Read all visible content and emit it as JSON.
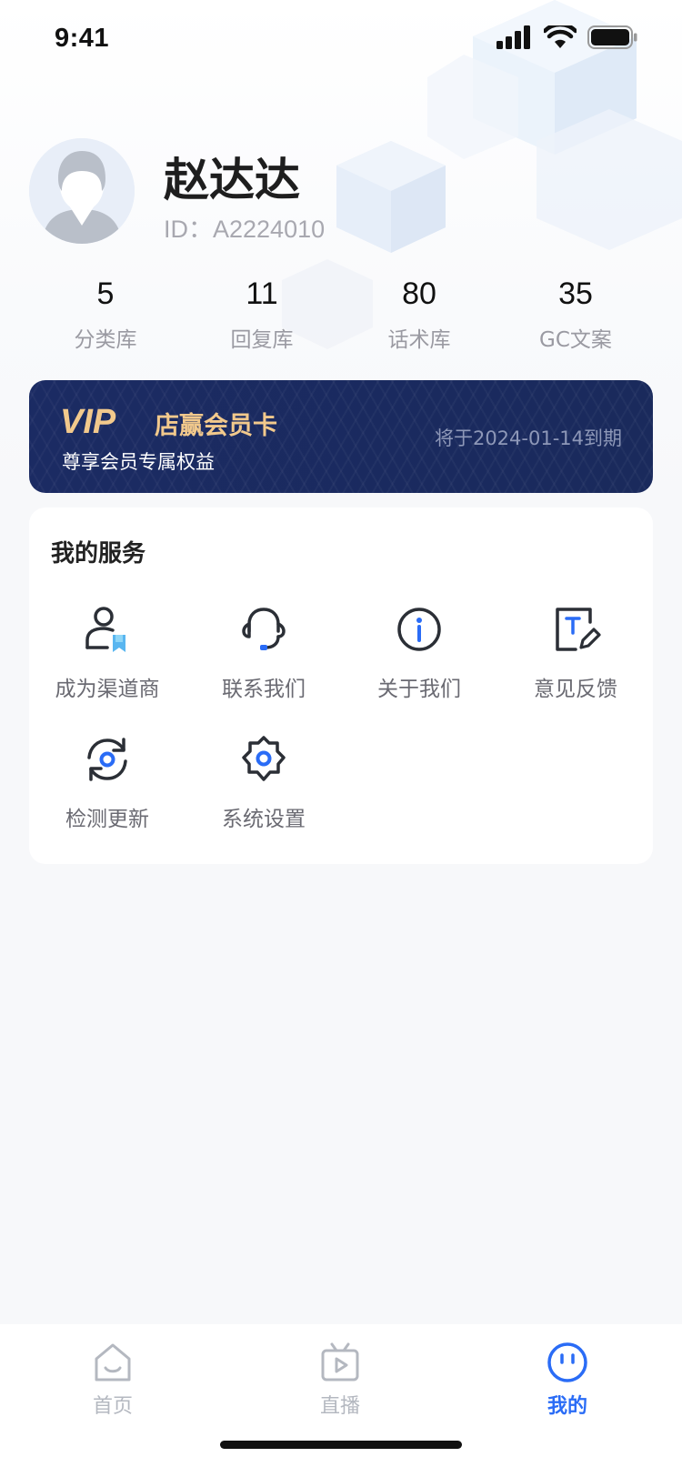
{
  "status_bar": {
    "time": "9:41"
  },
  "profile": {
    "name": "赵达达",
    "id_text": "ID：A2224010"
  },
  "stats": [
    {
      "value": "5",
      "label": "分类库"
    },
    {
      "value": "11",
      "label": "回复库"
    },
    {
      "value": "80",
      "label": "话术库"
    },
    {
      "value": "35",
      "label": "GC文案"
    }
  ],
  "vip": {
    "badge": "VIP",
    "title": "店赢会员卡",
    "subtitle": "尊享会员专属权益",
    "expire": "将于2024-01-14到期"
  },
  "services": {
    "title": "我的服务",
    "items": [
      {
        "label": "成为渠道商",
        "icon": "channel-partner-icon"
      },
      {
        "label": "联系我们",
        "icon": "headset-icon"
      },
      {
        "label": "关于我们",
        "icon": "info-icon"
      },
      {
        "label": "意见反馈",
        "icon": "feedback-icon"
      },
      {
        "label": "检测更新",
        "icon": "refresh-icon"
      },
      {
        "label": "系统设置",
        "icon": "settings-icon"
      }
    ]
  },
  "tabbar": {
    "items": [
      {
        "label": "首页",
        "icon": "home-icon",
        "active": false
      },
      {
        "label": "直播",
        "icon": "live-tv-icon",
        "active": false
      },
      {
        "label": "我的",
        "icon": "profile-face-icon",
        "active": true
      }
    ]
  },
  "colors": {
    "accent": "#2a6cf6",
    "vip_bg": "#1a2a5e",
    "vip_gold": "#f2c98c",
    "icon_stroke": "#2b2f36"
  }
}
